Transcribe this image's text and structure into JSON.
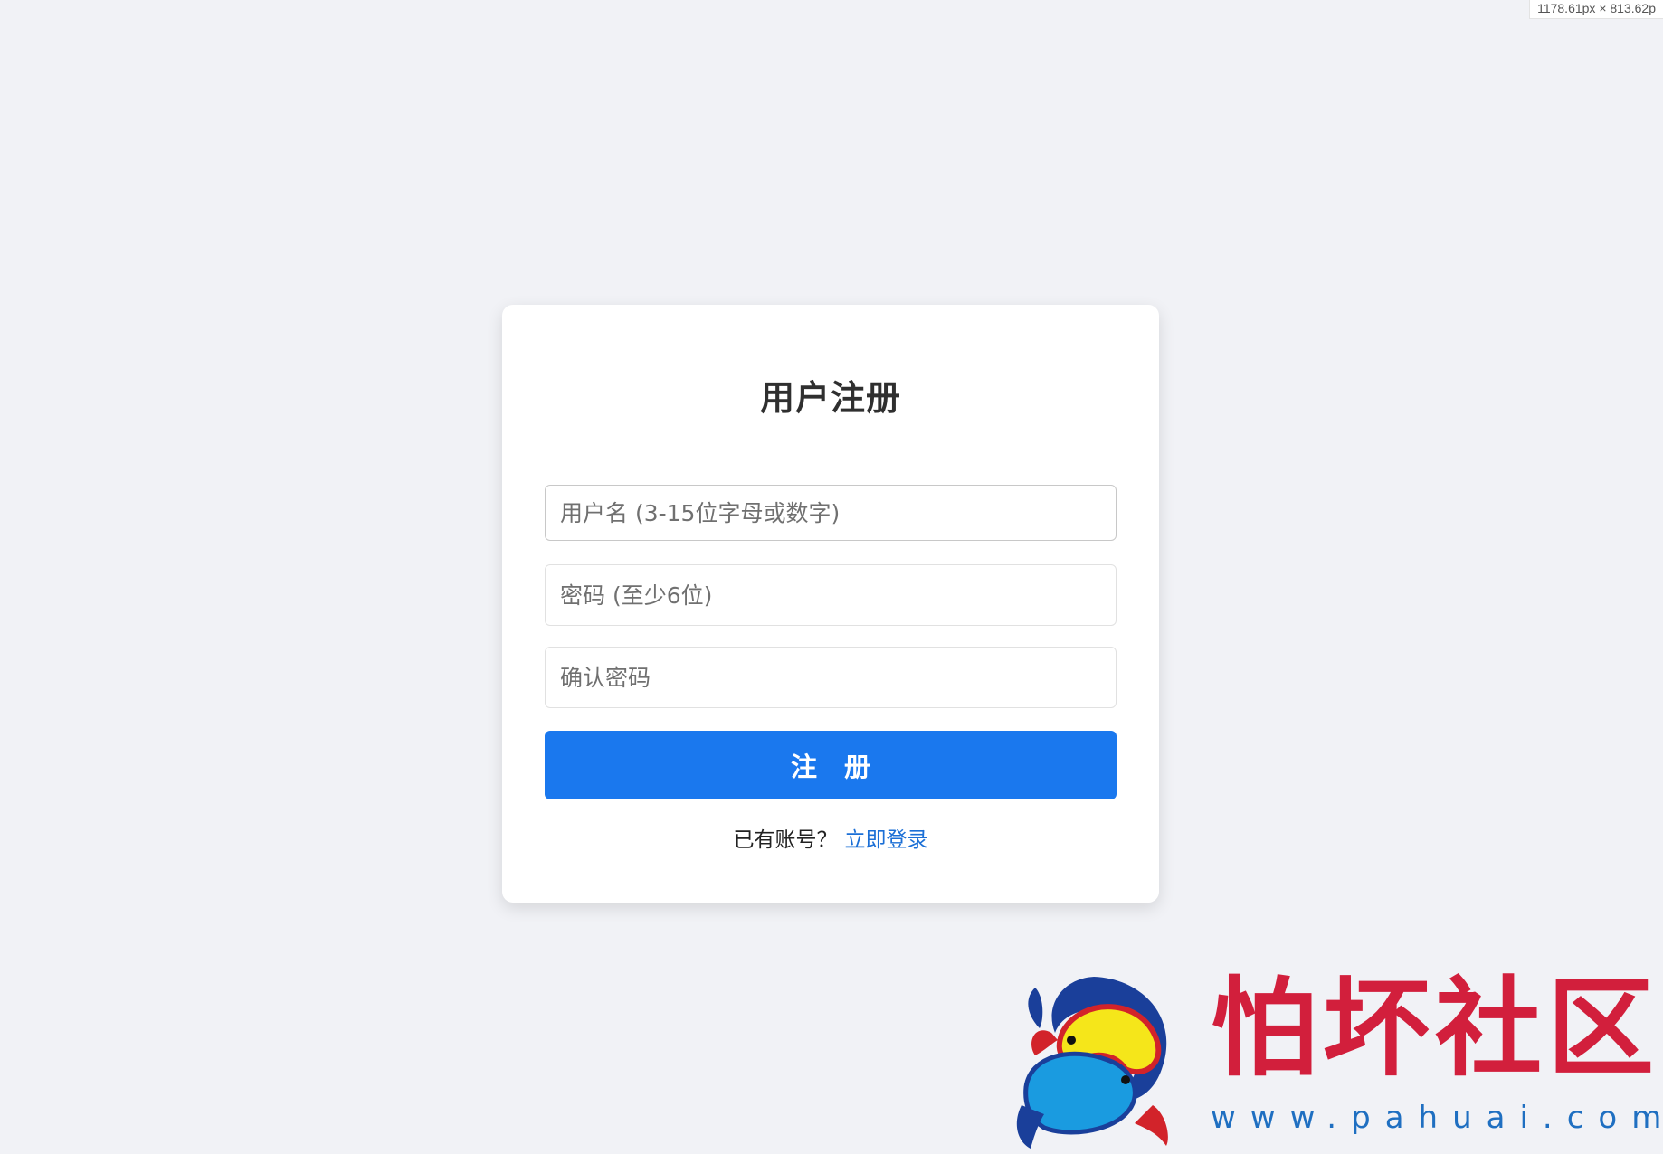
{
  "viewport_indicator": "1178.61px × 813.62p",
  "register_form": {
    "title": "用户注册",
    "username_placeholder": "用户名 (3-15位字母或数字)",
    "password_placeholder": "密码 (至少6位)",
    "confirm_placeholder": "确认密码",
    "submit_label": "注 册",
    "has_account_text": "已有账号？",
    "login_link": "立即登录"
  },
  "watermark": {
    "brand_text": "怕坏社区",
    "url": "www.pahuai.com",
    "logo_icon": "twin-fish-logo"
  },
  "colors": {
    "page_background": "#f1f2f6",
    "primary": "#1a78ee",
    "link": "#1b6fd6",
    "brand_red": "#d21f3c"
  }
}
